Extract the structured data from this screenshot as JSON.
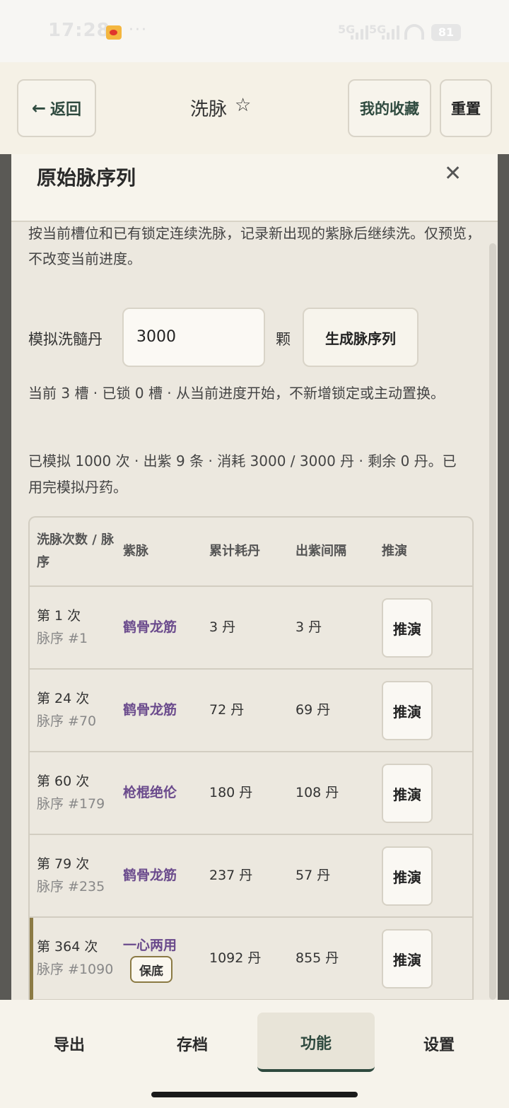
{
  "status": {
    "time": "17:28",
    "signal1": "5G",
    "signal2": "5G",
    "battery": "81"
  },
  "header": {
    "back_label": "返回",
    "title": "洗脉",
    "favorites_label": "我的收藏",
    "reset_label": "重置"
  },
  "modal": {
    "title": "原始脉序列",
    "description": "按当前槽位和已有锁定连续洗脉，记录新出现的紫脉后继续洗。仅预览，不改变当前进度。",
    "sim_label": "模拟洗髓丹",
    "sim_value": "3000",
    "unit": "颗",
    "generate_label": "生成脉序列",
    "info_line1": "当前 3 槽 · 已锁 0 槽 · 从当前进度开始，不新增锁定或主动置换。",
    "info_line2": "已模拟 1000 次 · 出紫 9 条 · 消耗 3000 / 3000 丹 · 剩余 0 丹。已用完模拟丹药。"
  },
  "table": {
    "headers": {
      "count": "洗脉次数 / 脉序",
      "vein": "紫脉",
      "cost": "累计耗丹",
      "gap": "出紫间隔",
      "action": "推演"
    },
    "rows": [
      {
        "count": "第 1 次",
        "seq": "脉序 #1",
        "vein": "鹤骨龙筋",
        "cost": "3 丹",
        "gap": "3 丹",
        "action": "推演"
      },
      {
        "count": "第 24 次",
        "seq": "脉序 #70",
        "vein": "鹤骨龙筋",
        "cost": "72 丹",
        "gap": "69 丹",
        "action": "推演"
      },
      {
        "count": "第 60 次",
        "seq": "脉序 #179",
        "vein": "枪棍绝伦",
        "cost": "180 丹",
        "gap": "108 丹",
        "action": "推演"
      },
      {
        "count": "第 79 次",
        "seq": "脉序 #235",
        "vein": "鹤骨龙筋",
        "cost": "237 丹",
        "gap": "57 丹",
        "action": "推演"
      },
      {
        "count": "第 364 次",
        "seq": "脉序 #1090",
        "vein": "一心两用",
        "badge": "保底",
        "cost": "1092 丹",
        "gap": "855 丹",
        "action": "推演"
      }
    ]
  },
  "nav": {
    "export": "导出",
    "archive": "存档",
    "functions": "功能",
    "settings": "设置"
  }
}
